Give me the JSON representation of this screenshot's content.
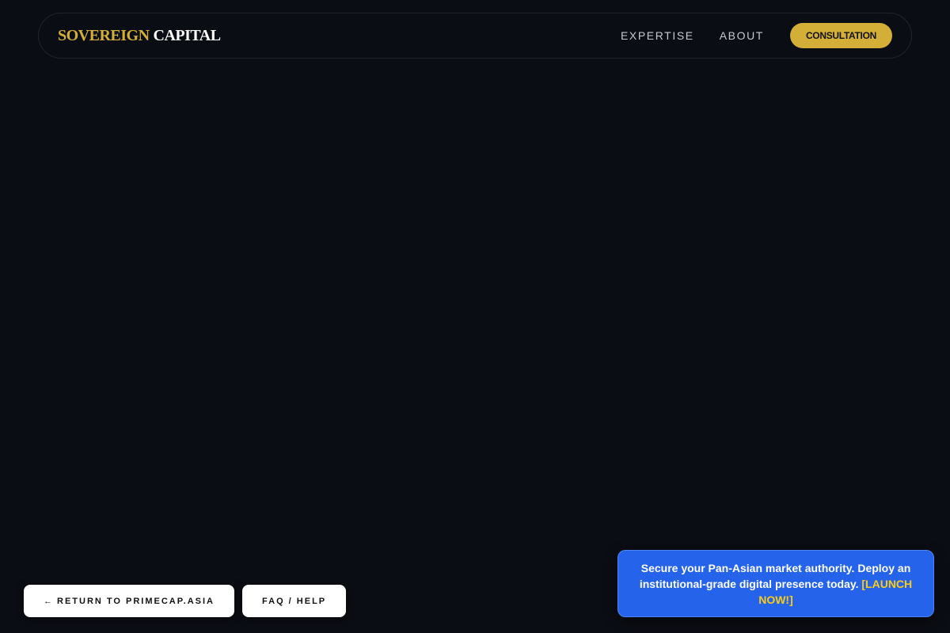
{
  "header": {
    "brand": {
      "primary": "SOVEREIGN",
      "secondary": "CAPITAL"
    },
    "nav": [
      {
        "label": "EXPERTISE"
      },
      {
        "label": "ABOUT"
      }
    ],
    "cta_label": "CONSULTATION"
  },
  "footer_buttons": {
    "return": {
      "arrow": "←",
      "label": "RETURN TO PRIMECAP.ASIA"
    },
    "faq": {
      "label": "FAQ / HELP"
    }
  },
  "promo": {
    "text": "Secure your Pan-Asian market authority. Deploy an institutional-grade digital presence today.",
    "link_label": "[LAUNCH NOW!]"
  },
  "colors": {
    "background": "#0b0d14",
    "gold": "#d4af37",
    "promo_blue": "#2563eb",
    "promo_link": "#facc15"
  }
}
